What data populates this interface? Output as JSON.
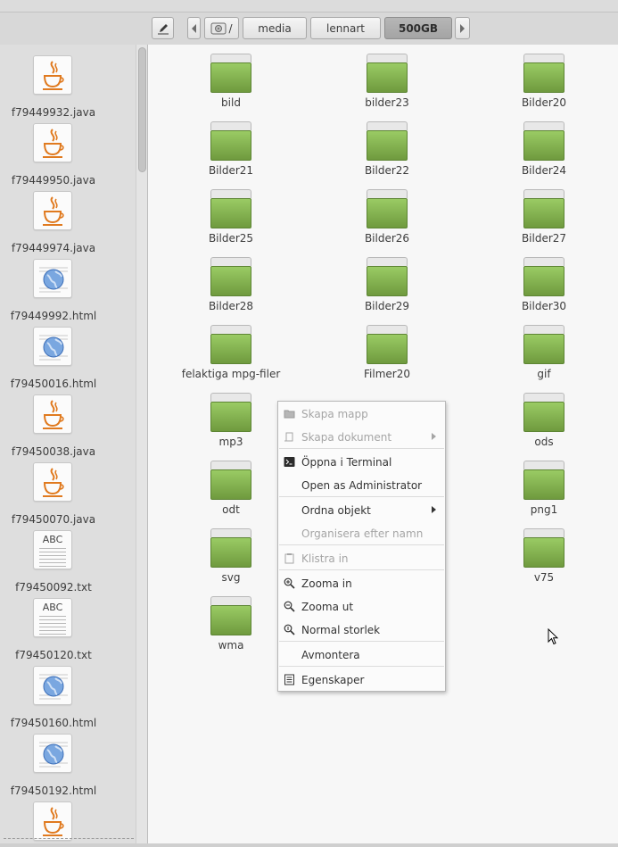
{
  "toolbar": {
    "root_label": "/",
    "crumbs": [
      "media",
      "lennart",
      "500GB"
    ]
  },
  "sidebar": {
    "files": [
      {
        "name": "f79449932.java",
        "type": "java"
      },
      {
        "name": "f79449950.java",
        "type": "java"
      },
      {
        "name": "f79449974.java",
        "type": "java"
      },
      {
        "name": "f79449992.html",
        "type": "html"
      },
      {
        "name": "f79450016.html",
        "type": "html"
      },
      {
        "name": "f79450038.java",
        "type": "java"
      },
      {
        "name": "f79450070.java",
        "type": "java"
      },
      {
        "name": "f79450092.txt",
        "type": "txt"
      },
      {
        "name": "f79450120.txt",
        "type": "txt"
      },
      {
        "name": "f79450160.html",
        "type": "html"
      },
      {
        "name": "f79450192.html",
        "type": "html"
      },
      {
        "name": "",
        "type": "java"
      }
    ],
    "txt_icon_text": "ABC"
  },
  "main": {
    "folders": [
      [
        "bild",
        "bilder23",
        "Bilder20"
      ],
      [
        "Bilder21",
        "Bilder22",
        "Bilder24"
      ],
      [
        "Bilder25",
        "Bilder26",
        "Bilder27"
      ],
      [
        "Bilder28",
        "Bilder29",
        "Bilder30"
      ],
      [
        "felaktiga mpg-filer",
        "Filmer20",
        "gif"
      ],
      [
        "mp3",
        "",
        "ods"
      ],
      [
        "odt",
        "",
        "png1"
      ],
      [
        "svg",
        "",
        "v75"
      ],
      [
        "wma",
        "",
        ""
      ]
    ]
  },
  "context_menu": {
    "items": [
      {
        "label": "Skapa mapp",
        "icon": "new-folder-icon",
        "disabled": true
      },
      {
        "label": "Skapa dokument",
        "icon": "new-document-icon",
        "disabled": true,
        "submenu": true
      },
      {
        "label": "Öppna i Terminal",
        "icon": "terminal-icon",
        "disabled": false
      },
      {
        "label": "Open as Administrator",
        "icon": "",
        "disabled": false
      },
      {
        "label": "Ordna objekt",
        "icon": "",
        "disabled": false,
        "submenu": true
      },
      {
        "label": "Organisera efter namn",
        "icon": "",
        "disabled": true
      },
      {
        "label": "Klistra in",
        "icon": "paste-icon",
        "disabled": true
      },
      {
        "label": "Zooma in",
        "icon": "zoom-in-icon",
        "disabled": false
      },
      {
        "label": "Zooma ut",
        "icon": "zoom-out-icon",
        "disabled": false
      },
      {
        "label": "Normal storlek",
        "icon": "zoom-normal-icon",
        "disabled": false
      },
      {
        "label": "Avmontera",
        "icon": "",
        "disabled": false
      },
      {
        "label": "Egenskaper",
        "icon": "properties-icon",
        "disabled": false
      }
    ]
  }
}
